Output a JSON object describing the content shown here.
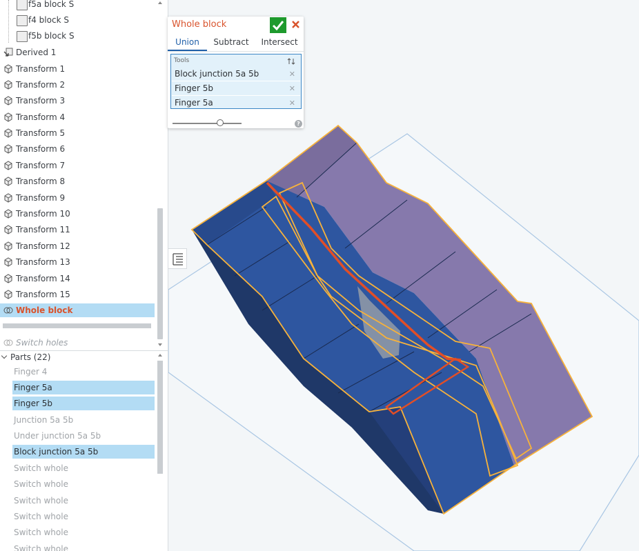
{
  "feature_tree": {
    "items": [
      {
        "label": "f5a block S"
      },
      {
        "label": "f4 block S"
      },
      {
        "label": "f5b block S"
      },
      {
        "label": "Derived 1"
      },
      {
        "label": "Transform 1"
      },
      {
        "label": "Transform 2"
      },
      {
        "label": "Transform 3"
      },
      {
        "label": "Transform 4"
      },
      {
        "label": "Transform 5"
      },
      {
        "label": "Transform 6"
      },
      {
        "label": "Transform 7"
      },
      {
        "label": "Transform 8"
      },
      {
        "label": "Transform 9"
      },
      {
        "label": "Transform 10"
      },
      {
        "label": "Transform 11"
      },
      {
        "label": "Transform 12"
      },
      {
        "label": "Transform 13"
      },
      {
        "label": "Transform 14"
      },
      {
        "label": "Transform 15"
      },
      {
        "label": "Whole block"
      }
    ],
    "rollback": {
      "label": "Switch holes"
    }
  },
  "parts": {
    "header": "Parts (22)",
    "items": [
      {
        "label": "Finger 4"
      },
      {
        "label": "Finger 5a"
      },
      {
        "label": "Finger 5b"
      },
      {
        "label": "Junction 5a 5b"
      },
      {
        "label": "Under junction 5a 5b"
      },
      {
        "label": "Block junction 5a 5b"
      },
      {
        "label": "Switch whole"
      },
      {
        "label": "Switch whole"
      },
      {
        "label": "Switch whole"
      },
      {
        "label": "Switch whole"
      },
      {
        "label": "Switch whole"
      },
      {
        "label": "Switch whole"
      }
    ]
  },
  "dialog": {
    "title": "Whole block",
    "tabs": [
      "Union",
      "Subtract",
      "Intersect"
    ],
    "active_tab": "Union",
    "tools_label": "Tools",
    "tools": [
      "Block junction 5a 5b",
      "Finger 5b",
      "Finger 5a"
    ],
    "help": "?"
  },
  "colors": {
    "accent": "#d9532c",
    "confirm": "#1e9a2d",
    "selection": "#b3dcf4",
    "part_blue": "#2b4f95",
    "part_purple": "#8679ac",
    "highlight_orange": "#f7b23b"
  }
}
